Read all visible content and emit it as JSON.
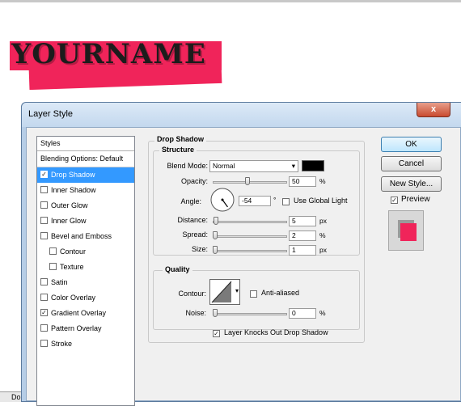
{
  "canvas": {
    "banner_text": "YOURNAME",
    "banner_color": "#f0245a"
  },
  "window": {
    "title": "Layer Style",
    "close_label": "x"
  },
  "styles_panel": {
    "header": "Styles",
    "items": [
      {
        "label": "Blending Options: Default",
        "checkbox": false,
        "checked": false,
        "selected": false
      },
      {
        "label": "Drop Shadow",
        "checkbox": true,
        "checked": true,
        "selected": true
      },
      {
        "label": "Inner Shadow",
        "checkbox": true,
        "checked": false,
        "selected": false
      },
      {
        "label": "Outer Glow",
        "checkbox": true,
        "checked": false,
        "selected": false
      },
      {
        "label": "Inner Glow",
        "checkbox": true,
        "checked": false,
        "selected": false
      },
      {
        "label": "Bevel and Emboss",
        "checkbox": true,
        "checked": false,
        "selected": false
      },
      {
        "label": "Contour",
        "checkbox": true,
        "checked": false,
        "selected": false
      },
      {
        "label": "Texture",
        "checkbox": true,
        "checked": false,
        "selected": false
      },
      {
        "label": "Satin",
        "checkbox": true,
        "checked": false,
        "selected": false
      },
      {
        "label": "Color Overlay",
        "checkbox": true,
        "checked": false,
        "selected": false
      },
      {
        "label": "Gradient Overlay",
        "checkbox": true,
        "checked": true,
        "selected": false
      },
      {
        "label": "Pattern Overlay",
        "checkbox": true,
        "checked": false,
        "selected": false
      },
      {
        "label": "Stroke",
        "checkbox": true,
        "checked": false,
        "selected": false
      }
    ]
  },
  "drop_shadow": {
    "section_title": "Drop Shadow",
    "structure": {
      "title": "Structure",
      "blend_mode_label": "Blend Mode:",
      "blend_mode_value": "Normal",
      "shadow_color": "#000000",
      "opacity_label": "Opacity:",
      "opacity_value": "50",
      "opacity_unit": "%",
      "angle_label": "Angle:",
      "angle_value": "-54",
      "angle_unit": "°",
      "global_light_label": "Use Global Light",
      "global_light_checked": false,
      "distance_label": "Distance:",
      "distance_value": "5",
      "distance_unit": "px",
      "spread_label": "Spread:",
      "spread_value": "2",
      "spread_unit": "%",
      "size_label": "Size:",
      "size_value": "1",
      "size_unit": "px"
    },
    "quality": {
      "title": "Quality",
      "contour_label": "Contour:",
      "anti_aliased_label": "Anti-aliased",
      "anti_aliased_checked": false,
      "noise_label": "Noise:",
      "noise_value": "0",
      "noise_unit": "%"
    },
    "knockout_label": "Layer Knocks Out Drop Shadow",
    "knockout_checked": true
  },
  "buttons": {
    "ok": "OK",
    "cancel": "Cancel",
    "new_style": "New Style..."
  },
  "preview": {
    "label": "Preview",
    "checked": true,
    "swatch_color": "#f0245a"
  },
  "taskbar": {
    "fragment": "Do"
  }
}
